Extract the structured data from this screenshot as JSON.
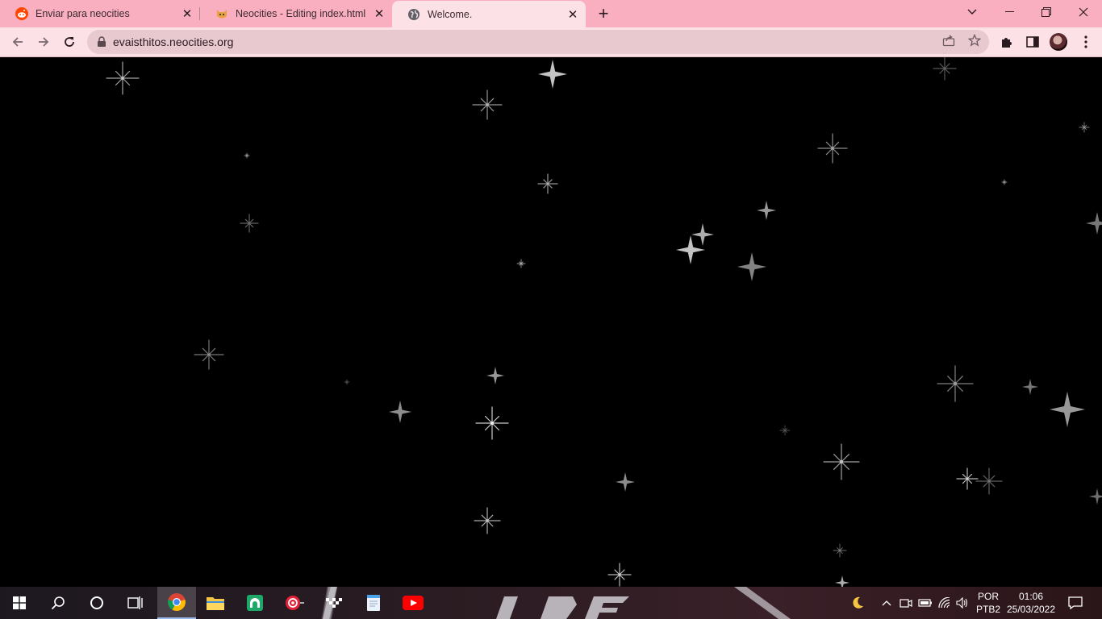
{
  "tabs": [
    {
      "title": "Enviar para neocities",
      "icon": "reddit-icon"
    },
    {
      "title": "Neocities - Editing index.html",
      "icon": "neocities-cat-icon"
    },
    {
      "title": "Welcome.",
      "icon": "globe-icon",
      "active": true
    }
  ],
  "address_bar": {
    "url": "evaisthitos.neocities.org"
  },
  "taskbar": {
    "language": "POR",
    "layout": "PTB2",
    "time": "01:06",
    "date": "25/03/2022"
  },
  "colors": {
    "tabstrip": "#f9afc0",
    "toolbar": "#fce1e7",
    "page_background": "#000000",
    "star": "#d8d8d8"
  }
}
